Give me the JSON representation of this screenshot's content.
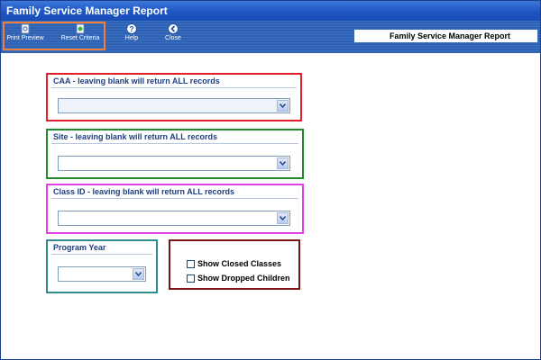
{
  "window": {
    "title": "Family Service Manager Report"
  },
  "toolbar": {
    "buttons": [
      {
        "label": "Print Preview",
        "icon": "print-preview-icon"
      },
      {
        "label": "Reset Criteria",
        "icon": "reset-criteria-icon"
      },
      {
        "label": "Help",
        "icon": "help-icon"
      },
      {
        "label": "Close",
        "icon": "close-icon"
      }
    ],
    "report_title": "Family Service Manager Report"
  },
  "filters": {
    "caa": {
      "label": "CAA - leaving blank will return ALL records",
      "value": ""
    },
    "site": {
      "label": "Site - leaving blank will return ALL records",
      "value": ""
    },
    "class_id": {
      "label": "Class ID - leaving blank will return ALL records",
      "value": ""
    },
    "program_year": {
      "label": "Program Year",
      "value": ""
    }
  },
  "options": {
    "show_closed_classes": "Show Closed Classes",
    "show_dropped_children": "Show Dropped Children"
  },
  "colors": {
    "caa_border": "#e0202b",
    "site_border": "#1f8a2e",
    "class_border": "#e040e6",
    "year_border": "#2f8e8a",
    "options_border": "#7a1414",
    "toolbar_group_border": "#f07f3c"
  }
}
